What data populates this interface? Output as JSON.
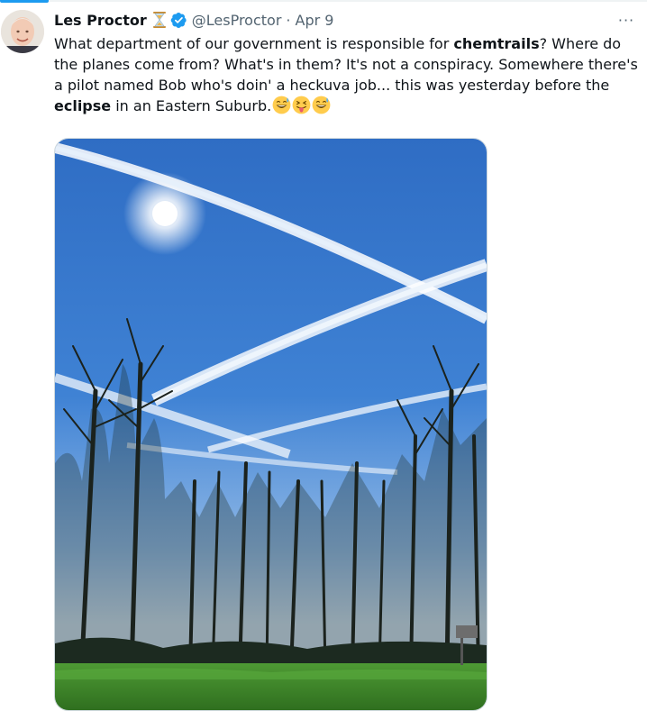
{
  "tweet": {
    "author_name": "Les Proctor",
    "handle": "@LesProctor",
    "separator": "·",
    "date": "Apr 9",
    "more_label": "···",
    "text_parts": {
      "p1": "What department of our government is responsible for ",
      "b1": "chemtrails",
      "p2": "? Where do the planes come from? What's in them? It's not a conspiracy. Somewhere there's a pilot named Bob who's doin' a heckuva job... this was yesterday before the ",
      "b2": "eclipse",
      "p3": " in an Eastern Suburb."
    },
    "emojis": [
      "grinning-sweat-emoji",
      "squinting-tongue-emoji",
      "grinning-sweat-emoji"
    ]
  },
  "colors": {
    "text": "#0f1419",
    "secondary": "#536471",
    "verified_blue": "#1d9bf0",
    "sky": "#3f7fd0",
    "grass": "#3e8a2a"
  }
}
